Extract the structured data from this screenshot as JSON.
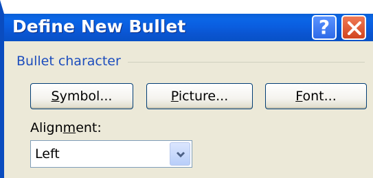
{
  "window": {
    "title": "Define New Bullet",
    "help_glyph": "?",
    "close_icon": "close-icon"
  },
  "group": {
    "label": "Bullet character"
  },
  "buttons": {
    "symbol": {
      "pre": "",
      "accel": "S",
      "post": "ymbol..."
    },
    "picture": {
      "pre": "",
      "accel": "P",
      "post": "icture..."
    },
    "font": {
      "pre": "",
      "accel": "F",
      "post": "ont..."
    }
  },
  "alignment": {
    "label_pre": "Align",
    "label_accel": "m",
    "label_post": "ent:",
    "selected": "Left"
  },
  "colors": {
    "titlebar": "#0a5ee0",
    "client_bg": "#ece9d8",
    "group_label": "#1c4dbd",
    "close_button": "#d1441f"
  }
}
